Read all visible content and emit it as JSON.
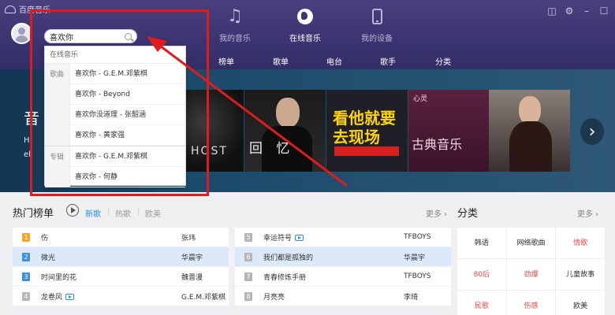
{
  "app": {
    "title": "百度音乐"
  },
  "search": {
    "value": "喜欢你"
  },
  "topnav": [
    {
      "label": "我的音乐"
    },
    {
      "label": "在线音乐"
    },
    {
      "label": "我的设备"
    }
  ],
  "subnav": [
    "榜单",
    "歌单",
    "电台",
    "歌手",
    "分类"
  ],
  "banner": {
    "left_title": "音",
    "left_sub": [
      "H.",
      "el"
    ],
    "tiles": [
      {
        "text": "HOST"
      },
      {
        "text": "回 忆"
      },
      {
        "text": "看他就要去现场"
      },
      {
        "text": "古典音乐",
        "top": "心灵"
      },
      {
        "text": ""
      }
    ]
  },
  "dropdown": {
    "header": "在线音乐",
    "groups": [
      {
        "label": "歌曲",
        "items": [
          "喜欢你 - G.E.M.邓紫棋",
          "喜欢你 - Beyond",
          "喜欢你没道理 - 张韶涵",
          "喜欢你 - 黄家强"
        ]
      },
      {
        "label": "专辑",
        "items": [
          "喜欢你 - G.E.M.邓紫棋",
          "喜欢你 - 何静"
        ]
      }
    ]
  },
  "hot": {
    "title": "热门榜单",
    "tabs": [
      "新歌",
      "热歌",
      "欧美"
    ],
    "more": "更多",
    "left": [
      {
        "rank": "1",
        "name": "伤",
        "artist": "张玮",
        "color": "orange"
      },
      {
        "rank": "2",
        "name": "微光",
        "artist": "华晨宇",
        "color": "blue"
      },
      {
        "rank": "3",
        "name": "时间里的花",
        "artist": "魏晋漫",
        "color": "blue"
      },
      {
        "rank": "4",
        "name": "龙卷风",
        "artist": "G.E.M.邓紫棋",
        "color": "gray"
      }
    ],
    "right": [
      {
        "rank": "5",
        "name": "幸运符号",
        "artist": "TFBOYS",
        "mv": true
      },
      {
        "rank": "6",
        "name": "我们都是孤独的",
        "artist": "华晨宇",
        "mv": false
      },
      {
        "rank": "7",
        "name": "青春修炼手册",
        "artist": "TFBOYS",
        "mv": false
      },
      {
        "rank": "8",
        "name": "月亮亮",
        "artist": "李琦",
        "mv": false
      }
    ]
  },
  "categories": {
    "title": "分类",
    "more": "更多",
    "items": [
      {
        "label": "韩语",
        "red": false
      },
      {
        "label": "网络歌曲",
        "red": false
      },
      {
        "label": "情歌",
        "red": true
      },
      {
        "label": "80后",
        "red": true
      },
      {
        "label": "劲爆",
        "red": true
      },
      {
        "label": "儿童故事",
        "red": false
      },
      {
        "label": "民歌",
        "red": true
      },
      {
        "label": "伤感",
        "red": true
      },
      {
        "label": "欧美",
        "red": false
      }
    ]
  }
}
